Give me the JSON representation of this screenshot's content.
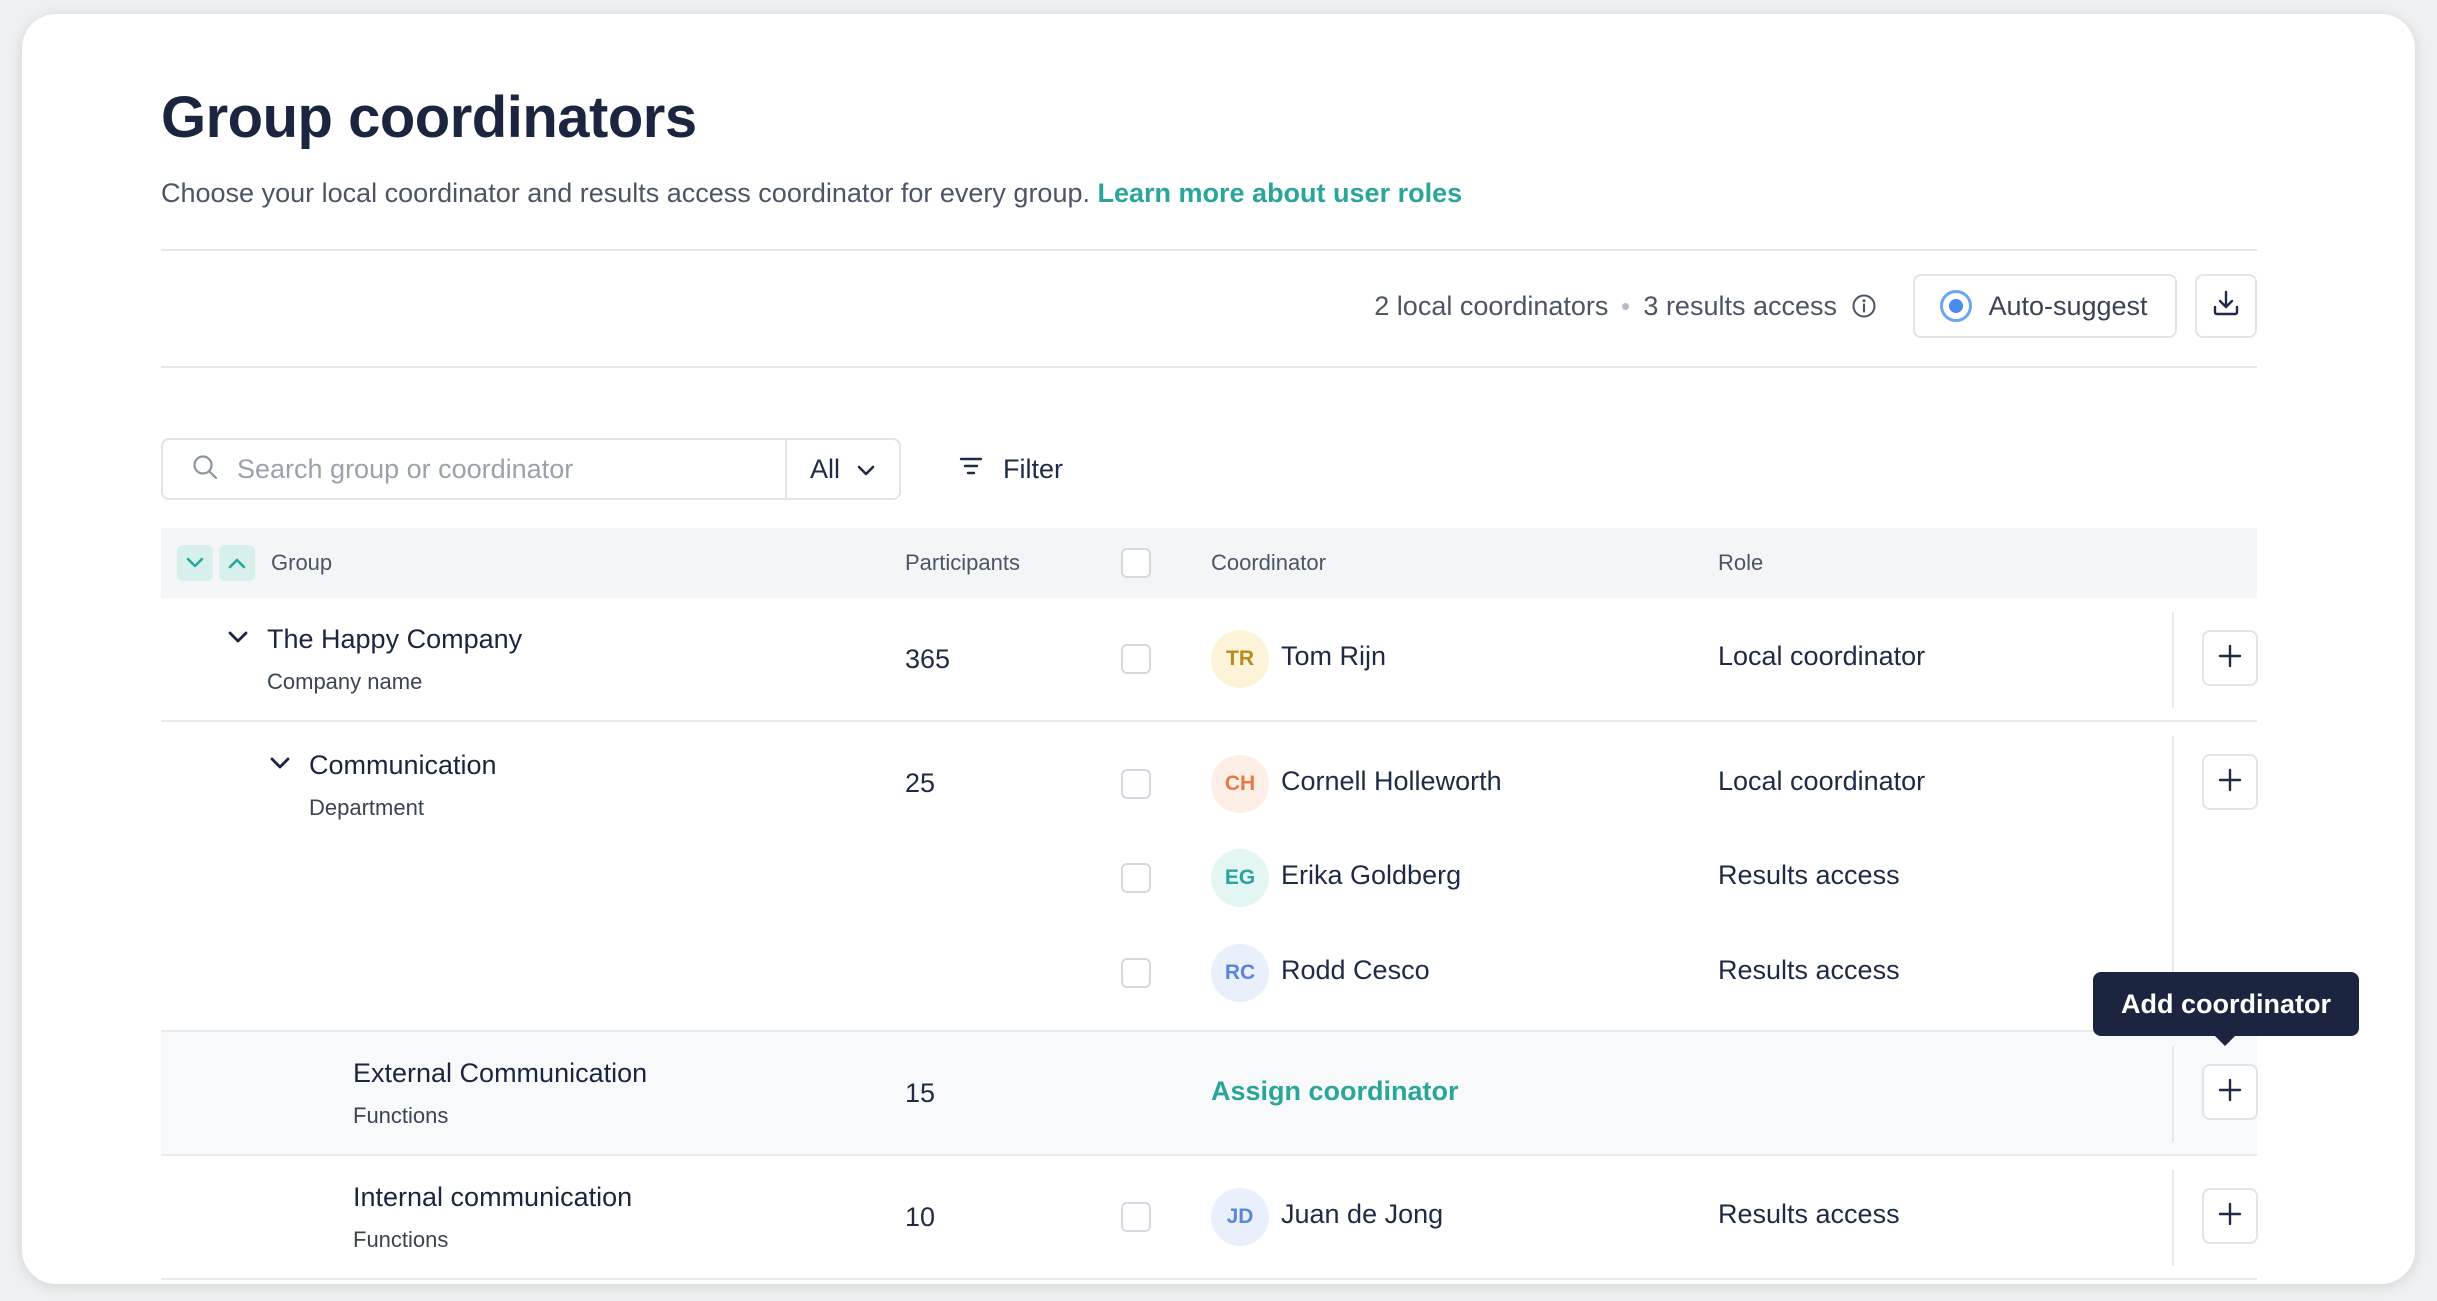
{
  "header": {
    "title": "Group coordinators",
    "subtitle": "Choose your local coordinator and results access coordinator for every group.",
    "learn_more_link": "Learn more about user roles"
  },
  "summary": {
    "local_coordinators": "2 local coordinators",
    "results_access": "3 results access",
    "auto_suggest_label": "Auto-suggest"
  },
  "toolbar": {
    "search_placeholder": "Search group or coordinator",
    "scope_select": "All",
    "filter_label": "Filter"
  },
  "table": {
    "columns": {
      "group": "Group",
      "participants": "Participants",
      "coordinator": "Coordinator",
      "role": "Role"
    },
    "rows": [
      {
        "name": "The Happy Company",
        "type": "Company name",
        "participants": "365",
        "coordinators": [
          {
            "initials": "TR",
            "name": "Tom Rijn",
            "role": "Local coordinator",
            "avatar_bg": "#fdf3d9",
            "avatar_fg": "#b98a1e"
          }
        ]
      },
      {
        "name": "Communication",
        "type": "Department",
        "participants": "25",
        "coordinators": [
          {
            "initials": "CH",
            "name": "Cornell Holleworth",
            "role": "Local coordinator",
            "avatar_bg": "#fdeee6",
            "avatar_fg": "#e47a47"
          },
          {
            "initials": "EG",
            "name": "Erika Goldberg",
            "role": "Results access",
            "avatar_bg": "#e3f6f4",
            "avatar_fg": "#2aa59a"
          },
          {
            "initials": "RC",
            "name": "Rodd Cesco",
            "role": "Results access",
            "avatar_bg": "#e9f0fc",
            "avatar_fg": "#5b86d6"
          }
        ]
      },
      {
        "name": "External Communication",
        "type": "Functions",
        "participants": "15",
        "assign_label": "Assign coordinator"
      },
      {
        "name": "Internal communication",
        "type": "Functions",
        "participants": "10",
        "coordinators": [
          {
            "initials": "JD",
            "name": "Juan de Jong",
            "role": "Results access",
            "avatar_bg": "#e9f0fc",
            "avatar_fg": "#5b86d6"
          }
        ]
      }
    ]
  },
  "tooltip": {
    "text": "Add coordinator"
  },
  "colors": {
    "accent": "#2aa59a",
    "title": "#1b2540",
    "tooltip_bg": "#1b2540"
  }
}
